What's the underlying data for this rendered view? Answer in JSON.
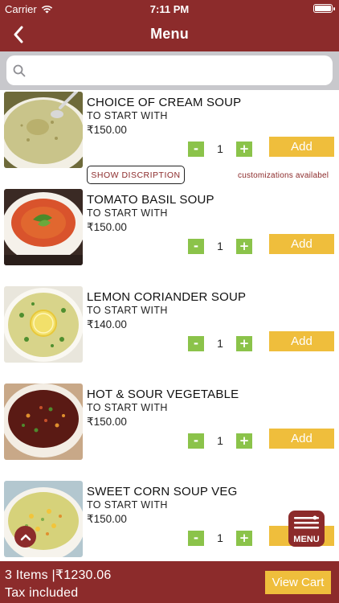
{
  "status_bar": {
    "carrier": "Carrier",
    "time": "7:11 PM"
  },
  "header": {
    "title": "Menu",
    "back_icon": "chevron-left-icon"
  },
  "search": {
    "placeholder": "",
    "value": "",
    "icon": "search-icon"
  },
  "items": [
    {
      "name": "CHOICE OF CREAM SOUP",
      "category": "TO START WITH",
      "price": "₹150.00",
      "qty": "1",
      "add_label": "Add",
      "show_desc_label": "SHOW DISCRIPTION",
      "custom_note": "customizations availabel",
      "image": "cream-soup-photo"
    },
    {
      "name": "TOMATO BASIL SOUP",
      "category": "TO START WITH",
      "price": "₹150.00",
      "qty": "1",
      "add_label": "Add",
      "image": "tomato-basil-soup-photo"
    },
    {
      "name": "LEMON CORIANDER SOUP",
      "category": "TO START WITH",
      "price": "₹140.00",
      "qty": "1",
      "add_label": "Add",
      "image": "lemon-coriander-soup-photo"
    },
    {
      "name": "HOT & SOUR VEGETABLE",
      "category": "TO START WITH",
      "price": "₹150.00",
      "qty": "1",
      "add_label": "Add",
      "image": "hot-sour-soup-photo"
    },
    {
      "name": "SWEET CORN SOUP VEG",
      "category": "TO START WITH",
      "price": "₹150.00",
      "qty": "1",
      "add_label": "Add",
      "image": "sweet-corn-soup-photo"
    }
  ],
  "qty_controls": {
    "minus": "-",
    "plus": "+"
  },
  "fab": {
    "menu_label": "MENU",
    "icon": "menu-list-icon",
    "scroll_up_icon": "chevron-up-icon"
  },
  "footer": {
    "summary": "3 Items |₹1230.06",
    "tax_note": "Tax included",
    "view_cart_label": "View Cart"
  },
  "colors": {
    "brand": "#8c2b2b",
    "accent": "#efbe3c",
    "stepper": "#8bc34a"
  }
}
